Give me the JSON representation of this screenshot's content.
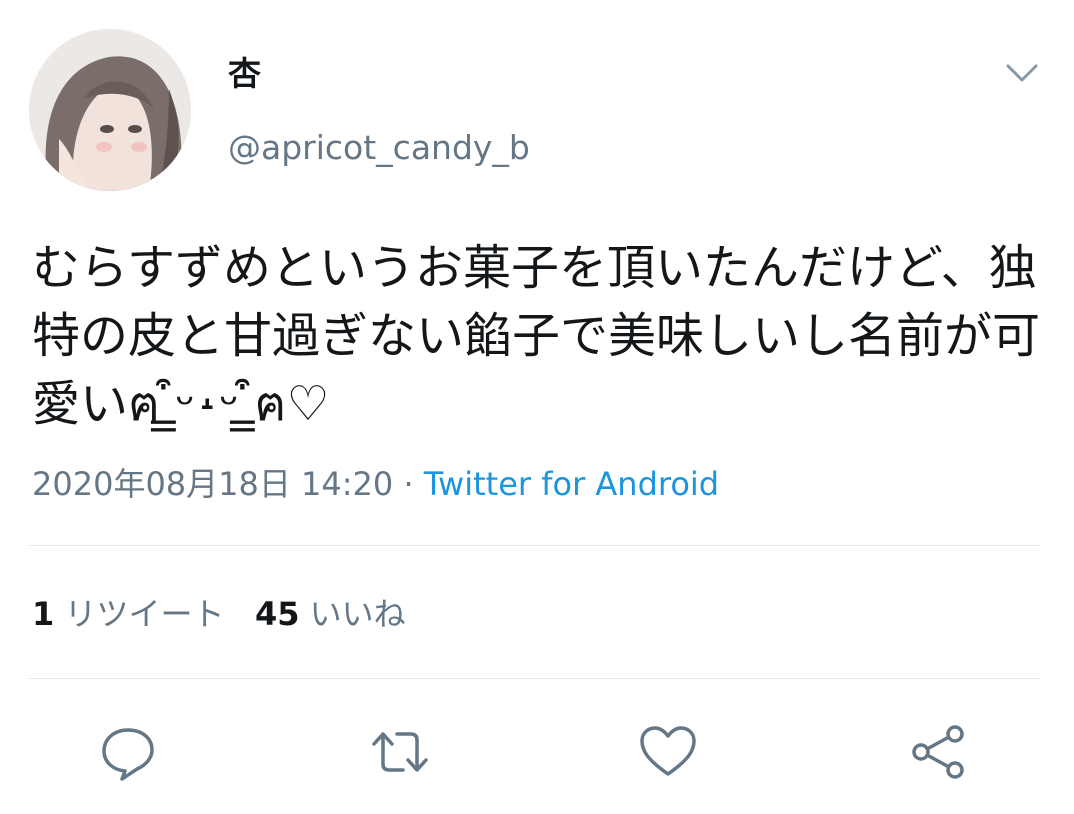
{
  "tweet": {
    "author": {
      "display_name": "杏",
      "handle": "@apricot_candy_b"
    },
    "text": "むらすずめというお菓子を頂いたんだけど、独特の皮と甘過ぎない餡子で美味しいし名前が可愛いฅ ̳͒ᵕ˔ᵕ ̳͒ฅ♡",
    "timestamp": "2020年08月18日 14:20",
    "separator": "·",
    "source": "Twitter for Android",
    "stats": {
      "retweet_count": "1",
      "retweet_label": "リツイート",
      "like_count": "45",
      "like_label": "いいね"
    },
    "actions": [
      "reply-icon",
      "retweet-icon",
      "like-icon",
      "share-icon"
    ]
  },
  "colors": {
    "text": "#14171a",
    "secondary": "#657786",
    "link": "#1b95e0",
    "divider": "#e1e8ed"
  }
}
